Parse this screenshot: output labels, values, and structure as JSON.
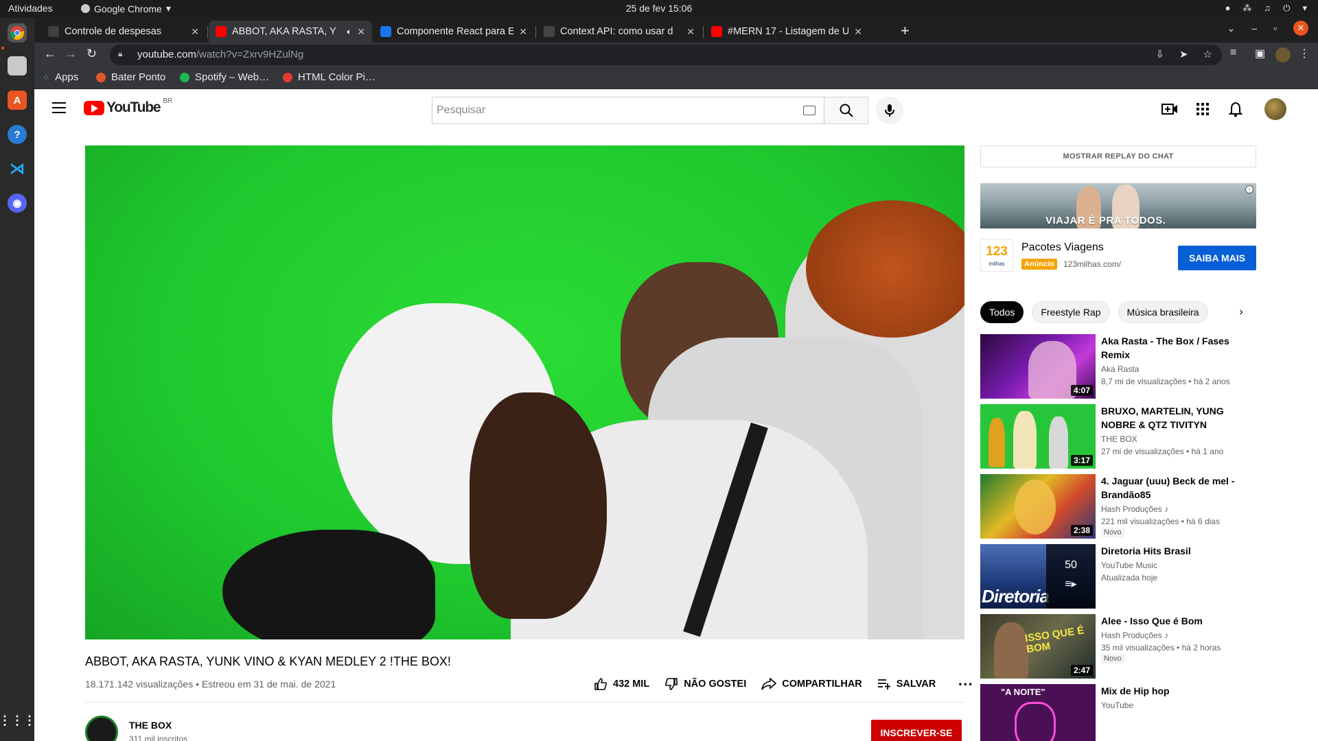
{
  "os": {
    "activities": "Atividades",
    "app_name": "Google Chrome",
    "clock": "25 de fev  15:06"
  },
  "tabs": [
    {
      "label": "Controle de despesas",
      "favicon_color": "#3c4043"
    },
    {
      "label": "ABBOT, AKA RASTA, Y",
      "favicon_color": "#ff0000"
    },
    {
      "label": "Componente React para E",
      "favicon_color": "#1a73e8"
    },
    {
      "label": "Context API: como usar d",
      "favicon_color": "#444444"
    },
    {
      "label": "#MERN 17 - Listagem de U",
      "favicon_color": "#ff0000"
    }
  ],
  "address": {
    "host": "youtube.com",
    "path": "/watch?v=Zxrv9HZulNg"
  },
  "bookmarks": [
    {
      "label": "Apps",
      "color": "#4285f4"
    },
    {
      "label": "Bater Ponto",
      "color": "#e2562b"
    },
    {
      "label": "Spotify – Web…",
      "color": "#1db954"
    },
    {
      "label": "HTML Color Pi…",
      "color": "#e53935"
    }
  ],
  "yt": {
    "logo_text": "YouTube",
    "country": "BR",
    "search_placeholder": "Pesquisar"
  },
  "video": {
    "title": "ABBOT, AKA RASTA, YUNK VINO & KYAN MEDLEY 2 !THE BOX!",
    "info": "18.171.142 visualizações • Estreou em 31 de mai. de 2021",
    "likes": "432 MIL",
    "dislike": "NÃO GOSTEI",
    "share": "COMPARTILHAR",
    "save": "SALVAR",
    "channel": "THE BOX",
    "subscribers": "311 mil inscritos",
    "subscribe": "INSCREVER-SE"
  },
  "sidebar": {
    "chat_replay": "MOSTRAR REPLAY DO CHAT",
    "ad": {
      "banner_text": "VIAJAR É PRA TODOS.",
      "logo_number": "123",
      "logo_word": "milhas",
      "title": "Pacotes Viagens",
      "badge": "Anúncio",
      "domain": "123milhas.com/",
      "cta": "SAIBA MAIS"
    },
    "chips": [
      "Todos",
      "Freestyle Rap",
      "Música brasileira"
    ],
    "recs": [
      {
        "title": "Aka Rasta - The Box / Fases Remix",
        "channel": "Aka Rasta",
        "stats": "8,7 mi de visualizações • há 2 anos",
        "duration": "4:07",
        "badge": ""
      },
      {
        "title": "BRUXO, MARTELIN, YUNG NOBRE & QTZ TIVITYN MEDLE…",
        "channel": "THE BOX",
        "stats": "27 mi de visualizações • há 1 ano",
        "duration": "3:17",
        "badge": ""
      },
      {
        "title": "4. Jaguar (uuu) Beck de mel - Brandão85",
        "channel": "Hash Produções ♪",
        "stats": "221 mil visualizações • há 6 dias",
        "duration": "2:38",
        "badge": "Novo"
      },
      {
        "title": "Diretoria Hits Brasil",
        "channel": "YouTube Music",
        "stats": "Atualizada hoje",
        "duration": "",
        "badge": "",
        "mix_count": "50",
        "thumb_text": "Diretoria"
      },
      {
        "title": "Alee - Isso Que é Bom",
        "channel": "Hash Produções ♪",
        "stats": "35 mil visualizações • há 2 horas",
        "duration": "2:47",
        "badge": "Novo",
        "thumb_text": "ISSO QUE É BOM"
      },
      {
        "title": "Mix de Hip hop",
        "channel": "YouTube",
        "stats": "",
        "duration": "",
        "badge": "",
        "thumb_text": "\"A NOITE\""
      }
    ]
  }
}
